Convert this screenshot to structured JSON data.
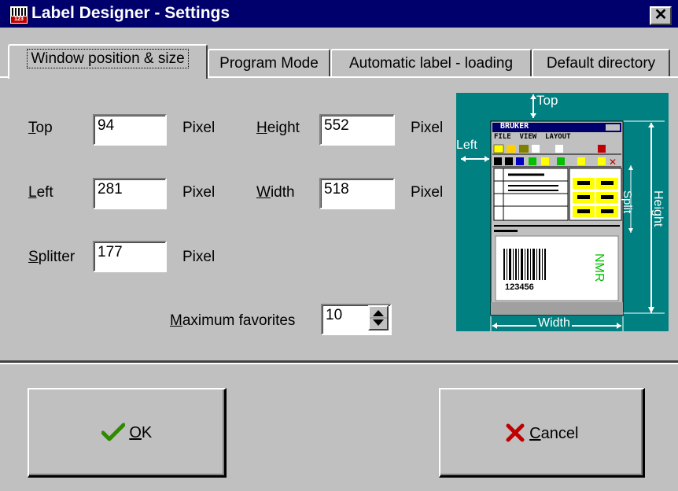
{
  "window": {
    "title": "Label Designer - Settings",
    "close_glyph": "✕",
    "icon": "barcode-app-icon"
  },
  "tabs": [
    {
      "label": "Window position & size",
      "active": true
    },
    {
      "label": "Program Mode",
      "active": false
    },
    {
      "label": "Automatic label - loading",
      "active": false
    },
    {
      "label": "Default directory",
      "active": false
    }
  ],
  "fields": {
    "top": {
      "label_key": "T",
      "label_rest": "op",
      "value": "94",
      "unit": "Pixel"
    },
    "left": {
      "label_key": "L",
      "label_rest": "eft",
      "value": "281",
      "unit": "Pixel"
    },
    "splitter": {
      "label_key": "S",
      "label_rest": "plitter",
      "value": "177",
      "unit": "Pixel"
    },
    "height": {
      "label_key": "H",
      "label_rest": "eight",
      "value": "552",
      "unit": "Pixel"
    },
    "width": {
      "label_key": "W",
      "label_rest": "idth",
      "value": "518",
      "unit": "Pixel"
    },
    "max_favorites": {
      "label_key": "M",
      "label_rest": "aximum favorites",
      "value": "10"
    }
  },
  "preview": {
    "top": "Top",
    "left": "Left",
    "split": "Split",
    "height": "Height",
    "width": "Width",
    "app_title": "BRUKER",
    "menu": "FILE  VIEW  LAYOUT",
    "barcode_number": "123456",
    "nmr": "NMR"
  },
  "buttons": {
    "ok": {
      "key": "O",
      "rest": "K",
      "icon": "checkmark-icon"
    },
    "cancel": {
      "key": "C",
      "rest": "ancel",
      "icon": "x-cross-icon"
    }
  },
  "colors": {
    "titlebar": "#00006c",
    "face": "#c0c0c0",
    "preview_bg": "#008080",
    "ok_check": "#2e8b00",
    "cancel_x": "#c00000"
  }
}
